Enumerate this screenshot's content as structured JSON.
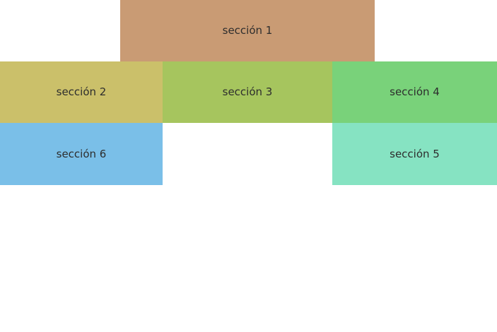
{
  "sections": {
    "s1": {
      "label": "sección 1",
      "color": "#c99b74"
    },
    "s2": {
      "label": "sección 2",
      "color": "#cbc06a"
    },
    "s3": {
      "label": "sección 3",
      "color": "#a6c55e"
    },
    "s4": {
      "label": "sección 4",
      "color": "#79d27a"
    },
    "s5": {
      "label": "sección 5",
      "color": "#86e3c2"
    },
    "s6": {
      "label": "sección 6",
      "color": "#7abfe8"
    }
  }
}
